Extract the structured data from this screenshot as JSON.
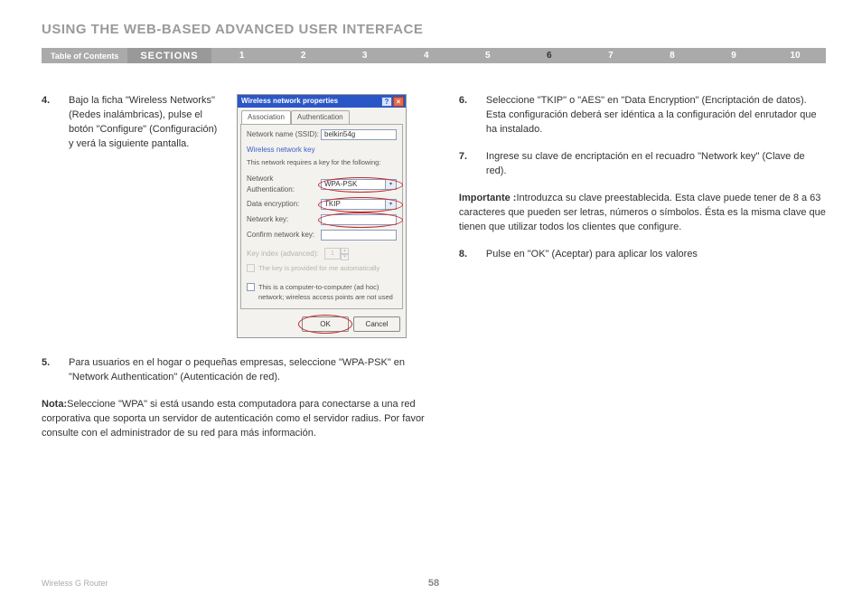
{
  "header": {
    "title": "USING THE WEB-BASED ADVANCED USER INTERFACE"
  },
  "nav": {
    "toc": "Table of Contents",
    "sections": "SECTIONS",
    "numbers": [
      "1",
      "2",
      "3",
      "4",
      "5",
      "6",
      "7",
      "8",
      "9",
      "10"
    ],
    "active_index": 5
  },
  "left": {
    "step4": {
      "num": "4.",
      "text": "Bajo la ficha \"Wireless Networks\" (Redes inalámbricas), pulse el botón \"Configure\" (Configuración) y verá la siguiente pantalla."
    },
    "step5": {
      "num": "5.",
      "text": "Para usuarios en el hogar o pequeñas empresas, seleccione \"WPA-PSK\" en \"Network Authentication\" (Autenticación de red)."
    },
    "note": {
      "label": "Nota:",
      "text": "Seleccione \"WPA\" si está usando esta computadora para conectarse a una red corporativa que soporta un servidor de autenticación como el servidor radius. Por favor consulte con el administrador de su red para más información."
    }
  },
  "right": {
    "step6": {
      "num": "6.",
      "text": "Seleccione \"TKIP\" o \"AES\" en \"Data Encryption\" (Encriptación de datos). Esta configuración deberá ser idéntica a la configuración del enrutador que ha instalado."
    },
    "step7": {
      "num": "7.",
      "text": "Ingrese su clave de encriptación en el recuadro \"Network key\" (Clave de red)."
    },
    "importante": {
      "label": "Importante :",
      "text": "Introduzca su clave preestablecida. Esta clave puede tener de 8 a 63 caracteres que pueden ser letras, números o símbolos. Ésta es la misma clave que tienen que utilizar todos los clientes que configure."
    },
    "step8": {
      "num": "8.",
      "text": "Pulse en \"OK\" (Aceptar) para aplicar los valores"
    }
  },
  "dialog": {
    "title": "Wireless network properties",
    "tabs": {
      "assoc": "Association",
      "auth": "Authentication"
    },
    "ssid_label": "Network name (SSID):",
    "ssid_value": "belkin54g",
    "section": "Wireless network key",
    "key_note": "This network requires a key for the following:",
    "auth_label": "Network Authentication:",
    "auth_value": "WPA-PSK",
    "enc_label": "Data encryption:",
    "enc_value": "TKIP",
    "netkey_label": "Network key:",
    "confirm_label": "Confirm network key:",
    "keyidx_label": "Key index (advanced):",
    "keyidx_value": "1",
    "auto_key": "The key is provided for me automatically",
    "adhoc": "This is a computer-to-computer (ad hoc) network; wireless access points are not used",
    "ok": "OK",
    "cancel": "Cancel"
  },
  "footer": {
    "left": "Wireless G Router",
    "page": "58"
  }
}
